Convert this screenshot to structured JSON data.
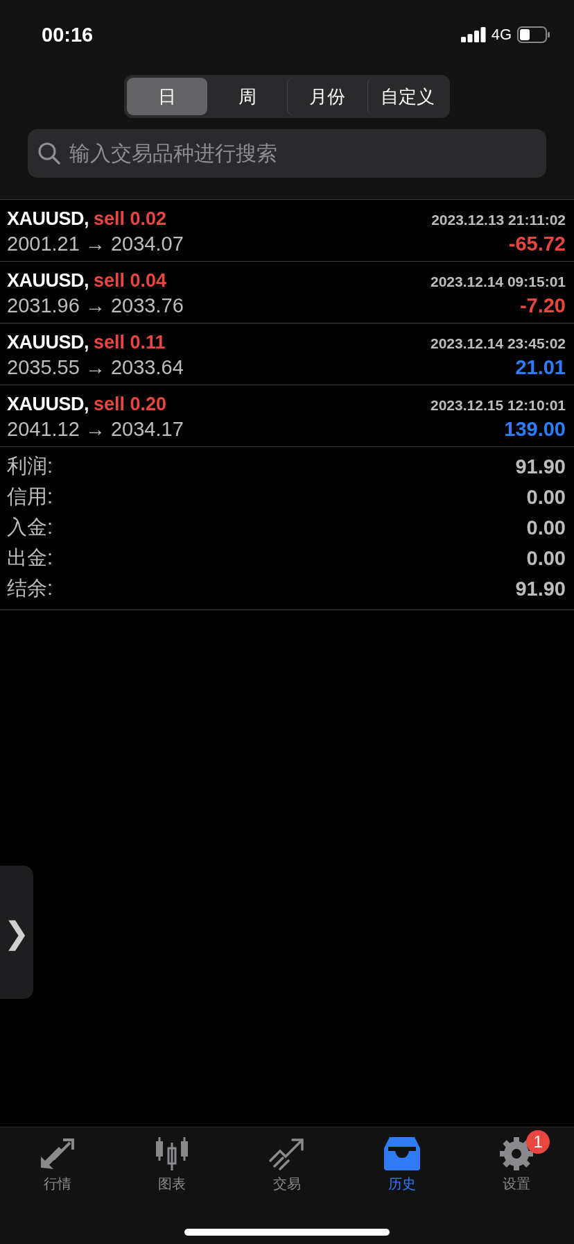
{
  "status_bar": {
    "time": "00:16",
    "network": "4G"
  },
  "period_tabs": [
    {
      "label": "日",
      "selected": true
    },
    {
      "label": "周",
      "selected": false
    },
    {
      "label": "月份",
      "selected": false
    },
    {
      "label": "自定义",
      "selected": false
    }
  ],
  "search": {
    "placeholder": "输入交易品种进行搜索"
  },
  "trades": [
    {
      "symbol": "XAUUSD,",
      "side": "sell 0.02",
      "time": "2023.12.13 21:11:02",
      "prices": "2001.21 → 2034.07",
      "profit": "-65.72",
      "color": "#e8463e"
    },
    {
      "symbol": "XAUUSD,",
      "side": "sell 0.04",
      "time": "2023.12.14 09:15:01",
      "prices": "2031.96 → 2033.76",
      "profit": "-7.20",
      "color": "#e8463e"
    },
    {
      "symbol": "XAUUSD,",
      "side": "sell 0.11",
      "time": "2023.12.14 23:45:02",
      "prices": "2035.55 → 2033.64",
      "profit": "21.01",
      "color": "#2f7cf6"
    },
    {
      "symbol": "XAUUSD,",
      "side": "sell 0.20",
      "time": "2023.12.15 12:10:01",
      "prices": "2041.12 → 2034.17",
      "profit": "139.00",
      "color": "#2f7cf6"
    }
  ],
  "summary": [
    {
      "label": "利润:",
      "value": "91.90"
    },
    {
      "label": "信用:",
      "value": "0.00"
    },
    {
      "label": "入金:",
      "value": "0.00"
    },
    {
      "label": "出金:",
      "value": "0.00"
    },
    {
      "label": "结余:",
      "value": "91.90"
    }
  ],
  "side_handle": {
    "glyph": "❯"
  },
  "tab_bar": [
    {
      "label": "行情",
      "kind": "quotes",
      "selected": false
    },
    {
      "label": "图表",
      "kind": "chart",
      "selected": false
    },
    {
      "label": "交易",
      "kind": "trade",
      "selected": false
    },
    {
      "label": "历史",
      "kind": "history",
      "selected": true
    },
    {
      "label": "设置",
      "kind": "settings",
      "selected": false,
      "badge": "1"
    }
  ]
}
